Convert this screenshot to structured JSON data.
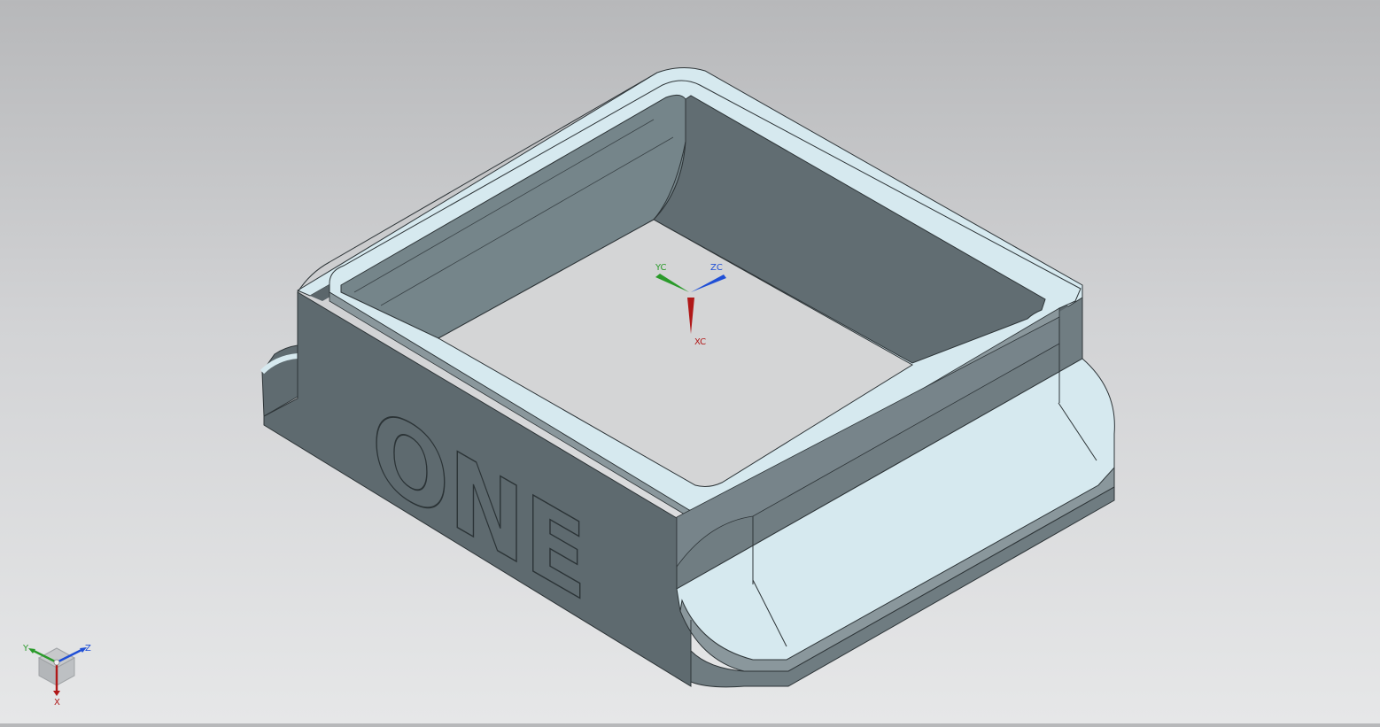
{
  "viewport": {
    "background_top": "#b7b8ba",
    "background_bottom": "#e6e7e8"
  },
  "model": {
    "engraved_text": "ONE",
    "body_color": "#657277",
    "face_light_color": "#d6e9ef",
    "floor_color": "#d4d5d6"
  },
  "wcs": {
    "x_label": "XC",
    "y_label": "YC",
    "z_label": "ZC",
    "x_color": "#b01818",
    "y_color": "#2a9a2a",
    "z_color": "#1f4fd6"
  },
  "triad": {
    "x_label": "X",
    "y_label": "Y",
    "z_label": "Z",
    "x_color": "#b01818",
    "y_color": "#2a9a2a",
    "z_color": "#1f4fd6",
    "cube_icon": "view-cube-icon"
  }
}
